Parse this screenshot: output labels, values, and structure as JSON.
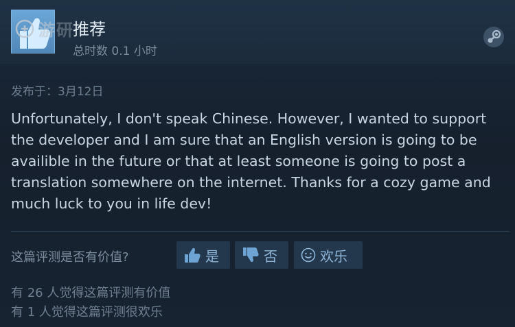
{
  "review": {
    "recommendation": "推荐",
    "hours": "总时数 0.1 小时",
    "posted": "发布于：3月12日",
    "body": "Unfortunately, I don't speak Chinese. However, I wanted to support the developer and I am sure that an English version is going to be availible in the future or that at least someone is going to post a translation somewhere on the internet. Thanks for a cozy game and much luck to you in life dev!"
  },
  "feedback": {
    "question": "这篇评测是否有价值?",
    "yes_label": "是",
    "no_label": "否",
    "funny_label": "欢乐",
    "helpful_count_text": "有 26 人觉得这篇评测有价值",
    "funny_count_text": "有 1 人觉得这篇评测很欢乐"
  },
  "icons": {
    "recommend": "thumbs-up-icon",
    "platform": "steam-icon",
    "yes": "thumbs-up-icon",
    "no": "thumbs-down-icon",
    "funny": "smiley-icon"
  },
  "colors": {
    "background": "#16202d",
    "accent": "#67a6db",
    "button_bg": "#23384d",
    "button_text": "#8fb6d8",
    "body_text": "#c9d6e1",
    "muted_text": "#6f8091"
  }
}
